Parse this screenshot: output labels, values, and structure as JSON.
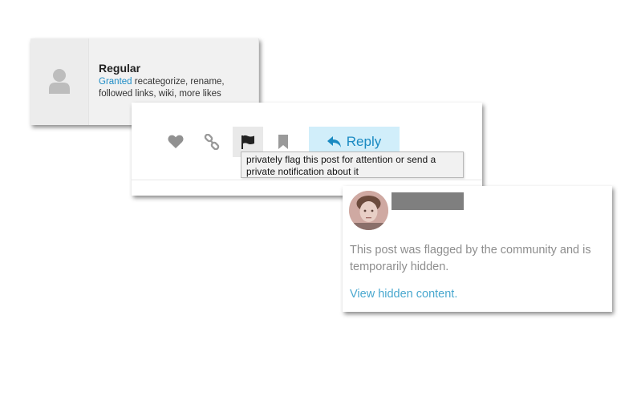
{
  "trust_card": {
    "title": "Regular",
    "granted_label": "Granted",
    "granted_text": " recategorize, rename, followed links, wiki, more likes"
  },
  "post_actions": {
    "like_icon": "heart-icon",
    "link_icon": "link-icon",
    "flag_icon": "flag-icon",
    "bookmark_icon": "bookmark-icon",
    "reply_label": "Reply",
    "flag_tooltip": "privately flag this post for attention or send a private notification about it"
  },
  "hidden_post": {
    "message": "This post was flagged by the community and is temporarily hidden.",
    "view_link": "View hidden content."
  },
  "colors": {
    "accent": "#1a8ac2",
    "reply_bg": "#d1eefa",
    "muted_text": "#8e8e8e",
    "link": "#4aa8cf"
  }
}
